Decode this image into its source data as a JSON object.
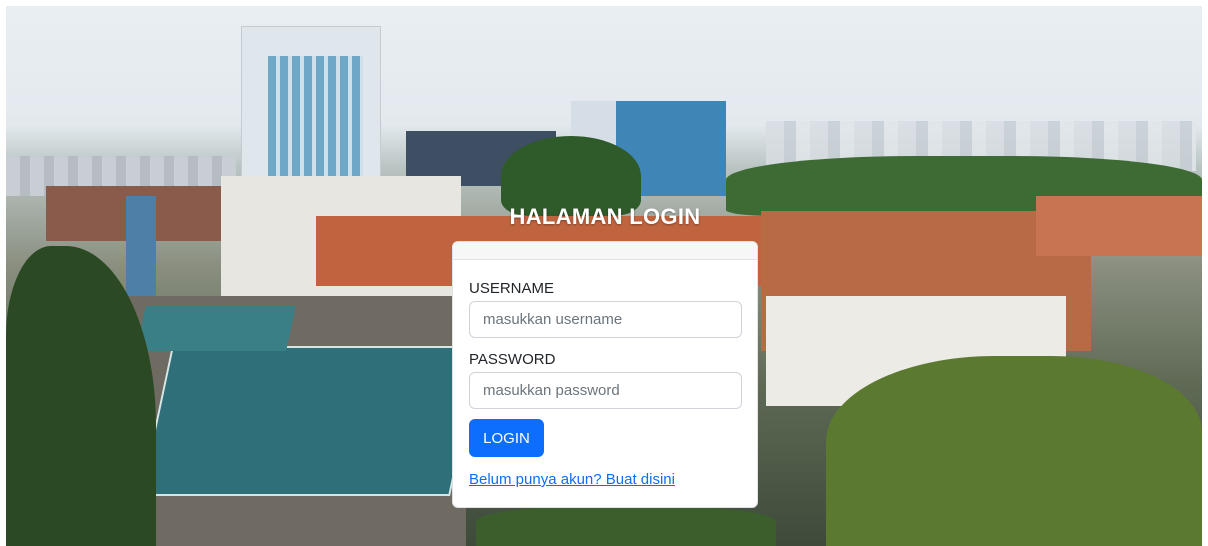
{
  "page": {
    "title": "HALAMAN LOGIN"
  },
  "form": {
    "username_label": "USERNAME",
    "username_placeholder": "masukkan username",
    "password_label": "PASSWORD",
    "password_placeholder": "masukkan password",
    "login_button": "LOGIN",
    "register_link": "Belum punya akun? Buat disini"
  },
  "colors": {
    "primary": "#0d6efd",
    "card": "#ffffff",
    "title_text": "#ffffff"
  }
}
